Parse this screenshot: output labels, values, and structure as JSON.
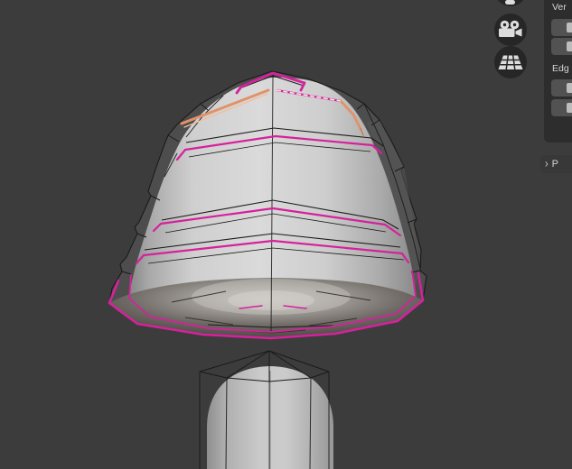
{
  "sidebar": {
    "vertex_section_label": "Ver",
    "edge_section_label": "Edg",
    "collapsed_panel_chevron": "›",
    "collapsed_panel_label": "P",
    "vertex_buttons": [
      {
        "glyph": "truncated-icon"
      },
      {
        "glyph": "truncated-icon"
      }
    ],
    "edge_buttons": [
      {
        "glyph": "truncated-icon"
      },
      {
        "glyph": "truncated-icon"
      }
    ]
  },
  "gizmo_buttons": [
    {
      "icon": "partial-circle-icon"
    },
    {
      "icon": "movie-camera-icon"
    },
    {
      "icon": "perspective-grid-icon"
    }
  ],
  "scene": {
    "selection_highlights": [
      "selected-edge-loops-magenta",
      "active-edge-orange",
      "active-edge-white"
    ]
  },
  "colors": {
    "viewport_bg": "#3c3c3c",
    "panel_bg": "#2d2d2d",
    "panel_header_bg": "#383838",
    "button_bg": "#525252",
    "button_glyph": "#bdbdbd",
    "label_text": "#d4d4d4",
    "icon_circle_bg": "#262626",
    "icon_glyph": "#dcdcdc",
    "selected_edge": "#d6219c",
    "active_orange": "#e09268",
    "active_orange_hi": "#f3bd9c",
    "active_white": "#f2ebe5",
    "wire": "#1a1a1a",
    "cage_fill": "#4d4d4d"
  }
}
